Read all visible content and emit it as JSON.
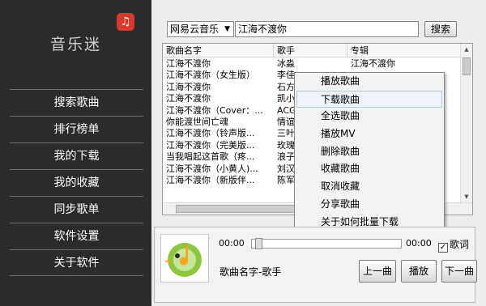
{
  "app": {
    "title": "音乐迷",
    "logo_glyph": "♫"
  },
  "sidebar": {
    "items": [
      {
        "label": "搜索歌曲"
      },
      {
        "label": "排行榜单"
      },
      {
        "label": "我的下载"
      },
      {
        "label": "我的收藏"
      },
      {
        "label": "同步歌单"
      },
      {
        "label": "软件设置"
      },
      {
        "label": "关于软件"
      }
    ]
  },
  "search": {
    "source": "网易云音乐",
    "query": "江海不渡你",
    "button_label": "搜索"
  },
  "table": {
    "columns": [
      "歌曲名字",
      "歌手",
      "专辑"
    ],
    "rows": [
      [
        "江海不渡你",
        "冰淼",
        "江海不渡你"
      ],
      [
        "江海不渡你（女生版）",
        "李佳",
        ""
      ],
      [
        "江海不渡你",
        "石方",
        ""
      ],
      [
        "江海不渡你",
        "凯小",
        ""
      ],
      [
        "江海不渡你（Cover：...",
        "ACG",
        ""
      ],
      [
        "你能渡世间亡魂",
        "情谊",
        ""
      ],
      [
        "江海不渡你（铃声版...",
        "三叶",
        ""
      ],
      [
        "江海不渡你（完美版...",
        "玫瑰",
        ""
      ],
      [
        "当我唱起这首歌（疼...",
        "浪子",
        ""
      ],
      [
        "江海不渡你（小黄人)...",
        "刘汉",
        ""
      ],
      [
        "江海不渡你（新版伴...",
        "陈军",
        ""
      ]
    ]
  },
  "context_menu": {
    "items": [
      {
        "label": "播放歌曲"
      },
      {
        "label": "下载歌曲"
      },
      {
        "label": "全选歌曲"
      },
      {
        "label": "播放MV"
      },
      {
        "label": "删除歌曲"
      },
      {
        "label": "收藏歌曲"
      },
      {
        "label": "取消收藏"
      },
      {
        "label": "分享歌曲"
      },
      {
        "label": "关于如何批量下载"
      }
    ],
    "highlighted": "下载歌曲"
  },
  "player": {
    "time_start": "00:00",
    "time_end": "00:00",
    "progress": 0,
    "lyrics_label": "歌词",
    "lyrics_checked": true,
    "song_info": "歌曲名字-歌手",
    "prev_label": "上一曲",
    "play_label": "播放",
    "next_label": "下一曲"
  },
  "colors": {
    "sidebar_bg": "#2b2b2b",
    "logo_red": "#d8392b",
    "art_green": "#7dbf2e"
  }
}
